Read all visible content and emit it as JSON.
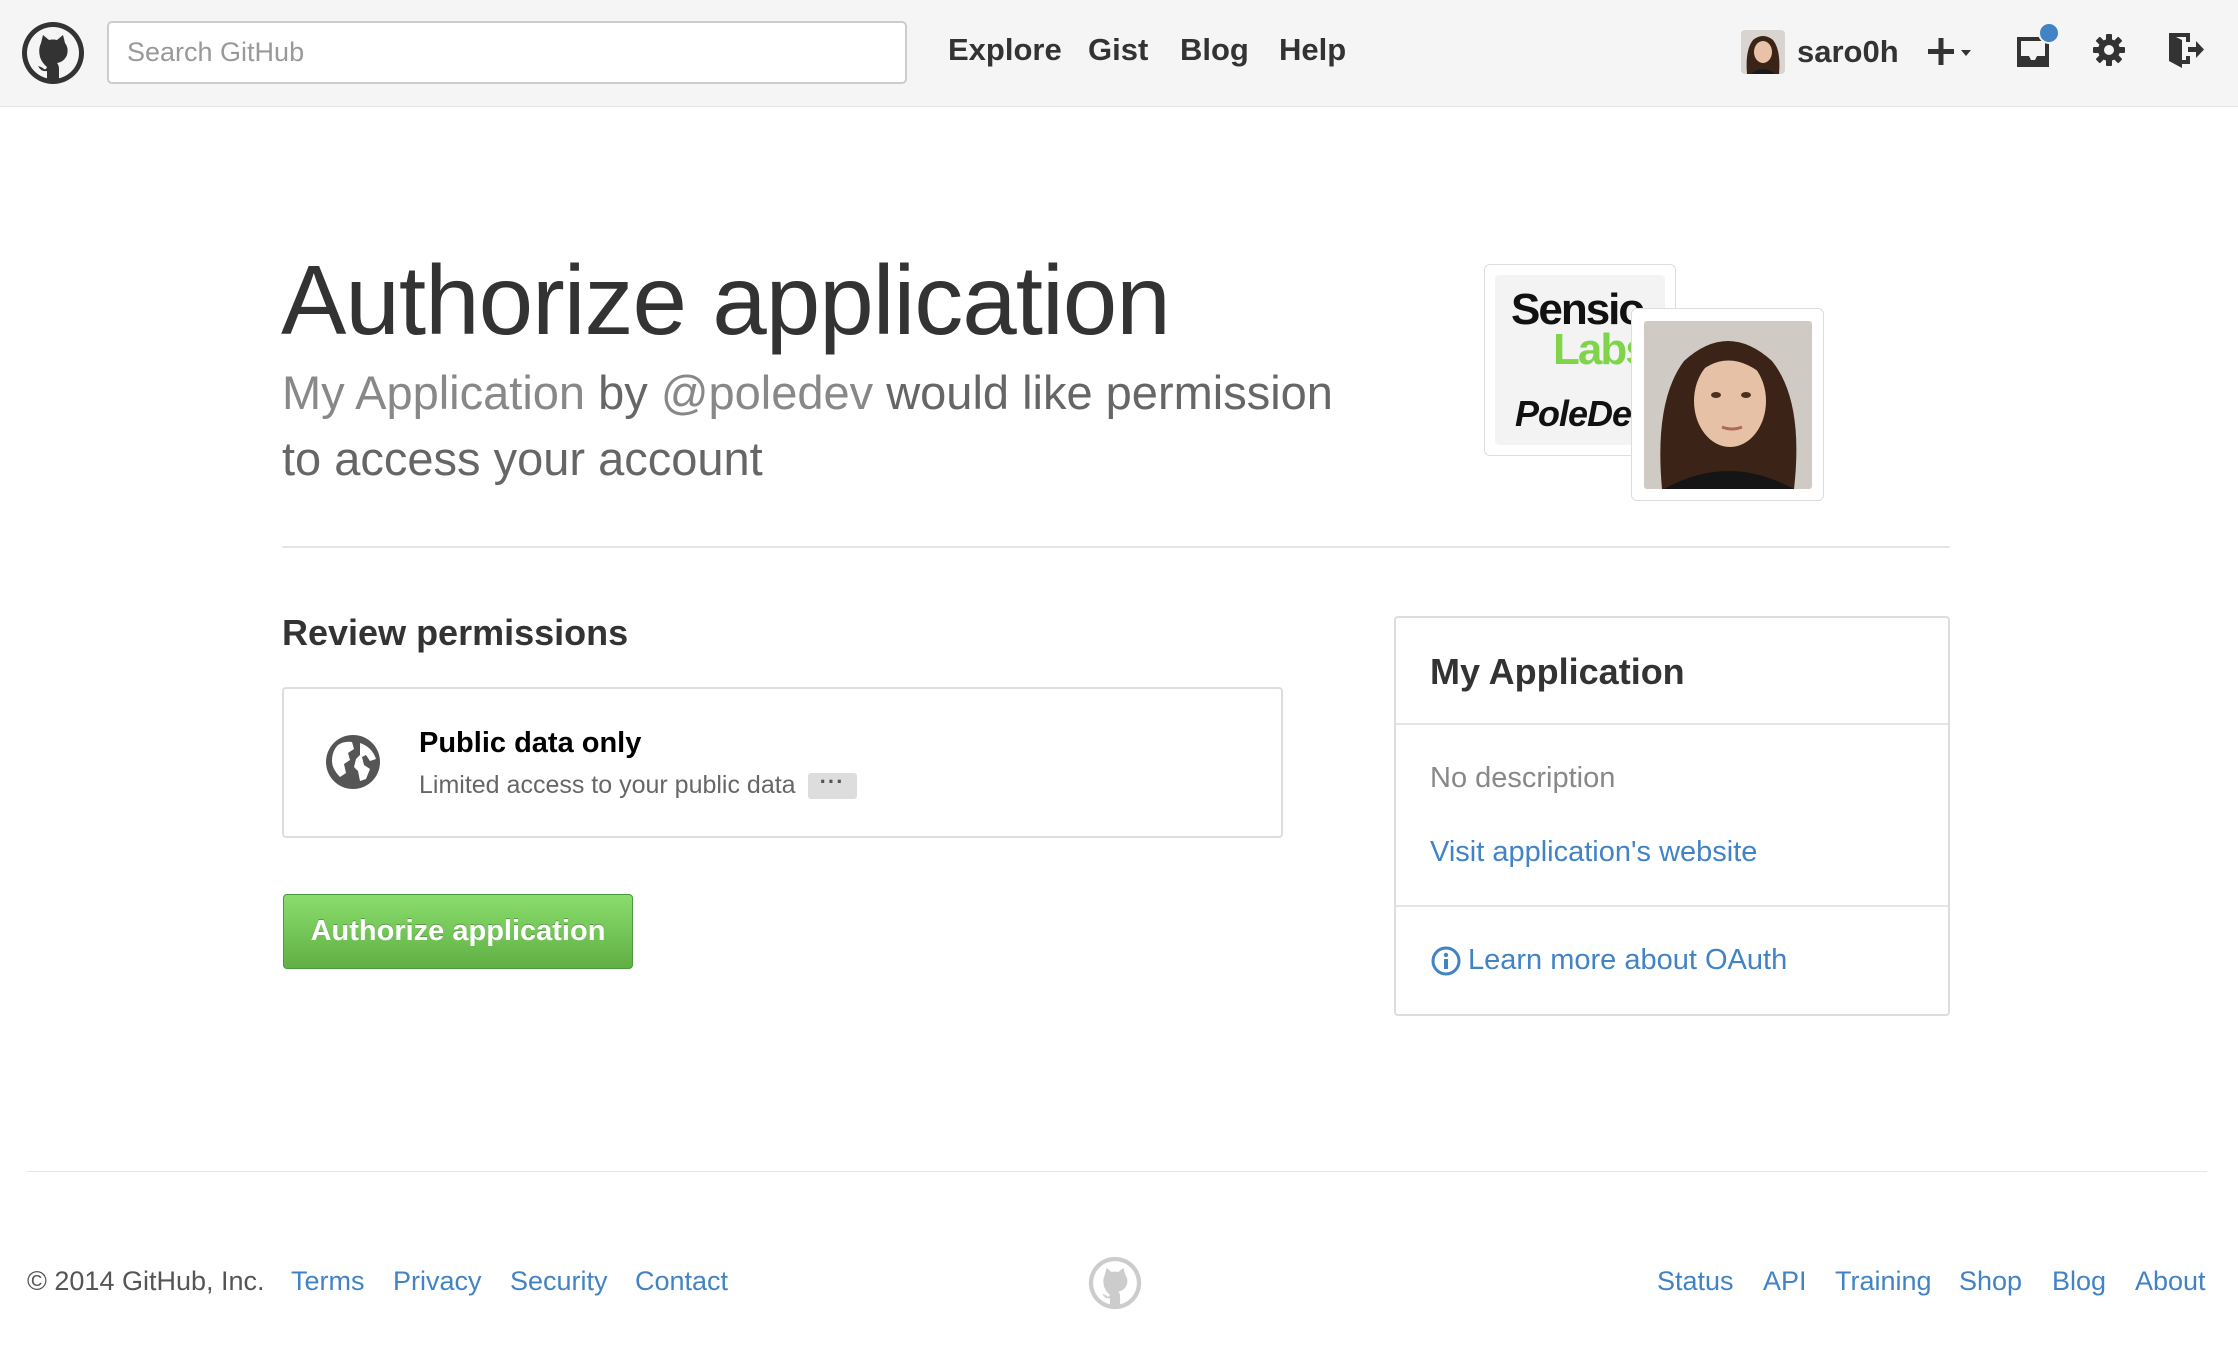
{
  "header": {
    "search_placeholder": "Search GitHub",
    "nav": [
      "Explore",
      "Gist",
      "Blog",
      "Help"
    ],
    "username": "saro0h",
    "icons": [
      "github-logo-icon",
      "plus-icon",
      "caret-down-icon",
      "inbox-icon",
      "gear-icon",
      "sign-out-icon"
    ]
  },
  "main": {
    "title": "Authorize application",
    "subtitle": {
      "app_name": "My Application",
      "by": " by ",
      "owner": "@poledev",
      "rest": " would like permission to access your account"
    },
    "app_logo_text": {
      "line1": "Sensio",
      "line2": "Labs",
      "line3": "PoleDev"
    },
    "review_heading": "Review permissions",
    "permission": {
      "title": "Public data only",
      "description": "Limited access to your public data",
      "more": "···"
    },
    "authorize_button": "Authorize application"
  },
  "sidebar": {
    "title": "My Application",
    "description": "No description",
    "website_link": "Visit application's website",
    "oauth_link": "Learn more about OAuth"
  },
  "footer": {
    "copyright": "© 2014 GitHub, Inc.",
    "left_links": [
      "Terms",
      "Privacy",
      "Security",
      "Contact"
    ],
    "right_links": [
      "Status",
      "API",
      "Training",
      "Shop",
      "Blog",
      "About"
    ]
  },
  "colors": {
    "link": "#4183c4",
    "button_green": "#60b044",
    "header_bg": "#f5f5f5"
  }
}
